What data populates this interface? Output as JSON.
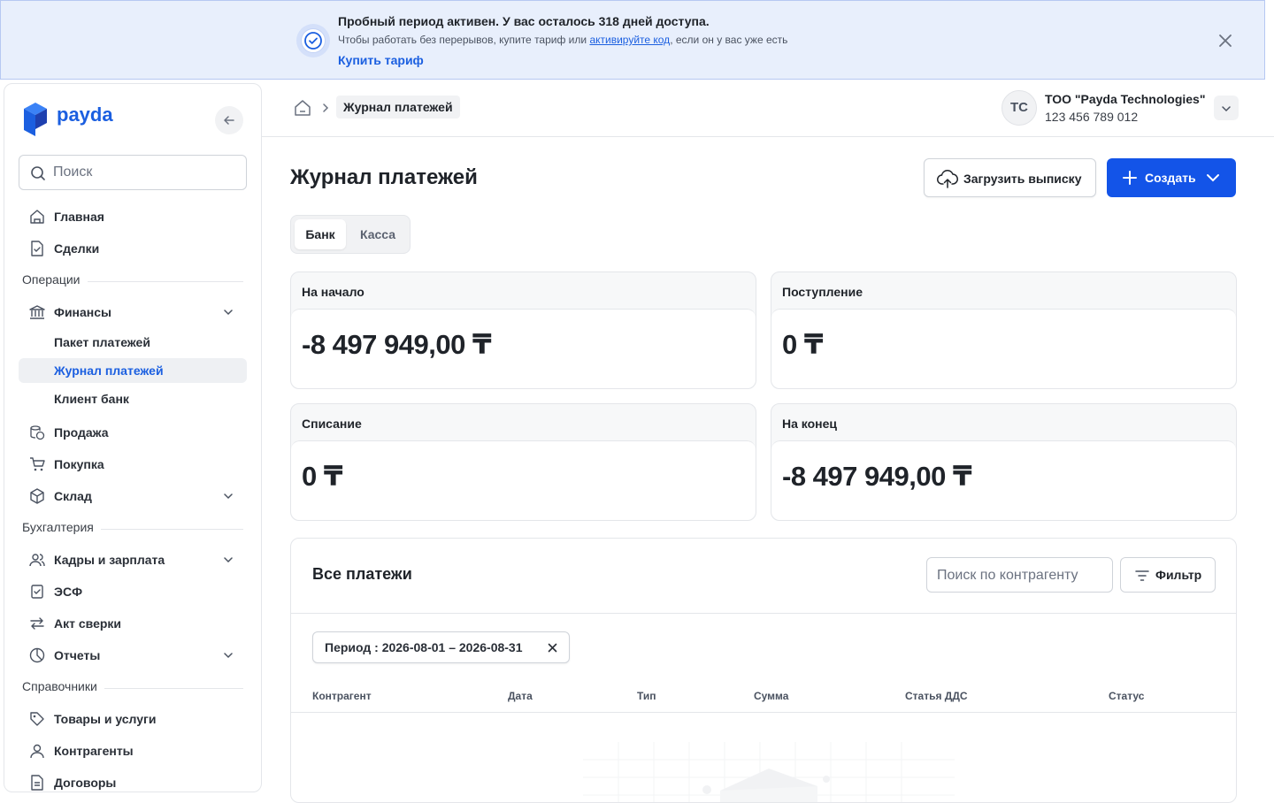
{
  "banner": {
    "title": "Пробный период активен. У вас осталось 318 дней доступа.",
    "text_before": "Чтобы работать без перерывов, купите тариф или ",
    "link": "активируйте код",
    "text_after": ", если он у вас уже есть",
    "buy": "Купить тариф"
  },
  "brand": {
    "name": "payda",
    "color": "#1b5fe0"
  },
  "search": {
    "placeholder": "Поиск"
  },
  "nav": {
    "home": "Главная",
    "deals": "Сделки",
    "section_ops": "Операции",
    "finance": "Финансы",
    "packet": "Пакет платежей",
    "journal": "Журнал платежей",
    "clientbank": "Клиент банк",
    "sales": "Продажа",
    "purchase": "Покупка",
    "warehouse": "Склад",
    "section_acc": "Бухгалтерия",
    "hr": "Кадры и зарплата",
    "esf": "ЭСФ",
    "reconcile": "Акт сверки",
    "reports": "Отчеты",
    "section_ref": "Справочники",
    "goods": "Товары и услуги",
    "contractors": "Контрагенты",
    "contracts": "Договоры"
  },
  "header": {
    "breadcrumb_current": "Журнал платежей",
    "avatar_initials": "TC",
    "org_name": "ТОО \"Payda Technologies\"",
    "org_bin": "123 456 789 012"
  },
  "page": {
    "title": "Журнал платежей",
    "upload_label": "Загрузить выписку",
    "create_label": "Создать",
    "tab_bank": "Банк",
    "tab_cash": "Касса"
  },
  "cards": {
    "start": {
      "label": "На начало",
      "value": "-8 497 949,00 ₸"
    },
    "income": {
      "label": "Поступление",
      "value": "0 ₸"
    },
    "outgo": {
      "label": "Списание",
      "value": "0 ₸"
    },
    "end": {
      "label": "На конец",
      "value": "-8 497 949,00 ₸"
    }
  },
  "payments": {
    "title": "Все платежи",
    "search_placeholder": "Поиск по контрагенту",
    "filter_label": "Фильтр",
    "period_chip": "Период : 2026-08-01 – 2026-08-31",
    "columns": [
      "Контрагент",
      "Дата",
      "Тип",
      "Сумма",
      "Статья ДДС",
      "Статус"
    ]
  },
  "colors": {
    "accent": "#1354e8",
    "banner_bg": "#e8effc",
    "active_nav_text": "#1b5fe0"
  }
}
